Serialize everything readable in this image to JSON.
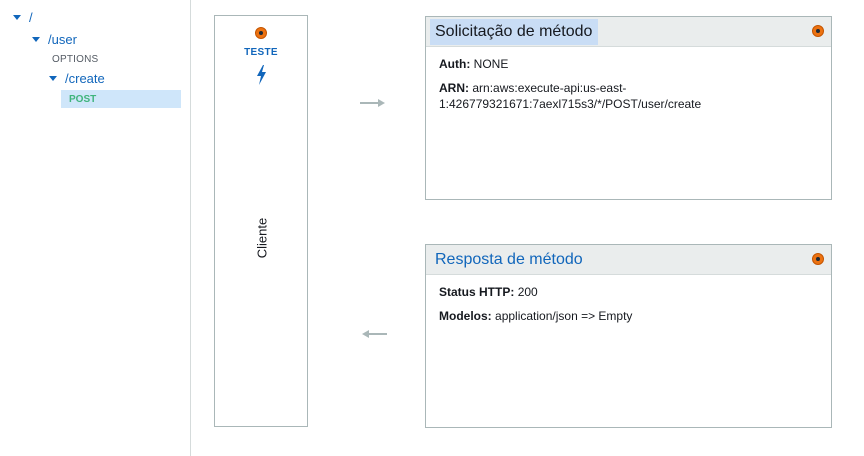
{
  "tree": {
    "root": "/",
    "user": "/user",
    "options": "OPTIONS",
    "create": "/create",
    "post": "POST"
  },
  "client": {
    "test_label": "TESTE",
    "label": "Cliente"
  },
  "request_panel": {
    "title": "Solicitação de método",
    "auth_label": "Auth:",
    "auth_value": "NONE",
    "arn_label": "ARN:",
    "arn_value_line1": "arn:aws:execute-api:us-east-",
    "arn_value_line2": "1:426779321671:7aexl715s3/*/POST/user/create"
  },
  "response_panel": {
    "title": "Resposta de método",
    "status_label": "Status HTTP:",
    "status_value": "200",
    "models_label": "Modelos:",
    "models_value": "application/json => Empty"
  },
  "icons": {
    "test": "orange-dot-icon",
    "lightning": "lightning-bolt-icon",
    "arrow_right": "arrow-right-icon",
    "arrow_left": "arrow-left-icon"
  },
  "colors": {
    "accent": "#ec7211",
    "link": "#1166bb",
    "selected_bg": "#cfe6fa",
    "post_method": "#3fb47c",
    "title_highlight": "#c9ddf5"
  }
}
